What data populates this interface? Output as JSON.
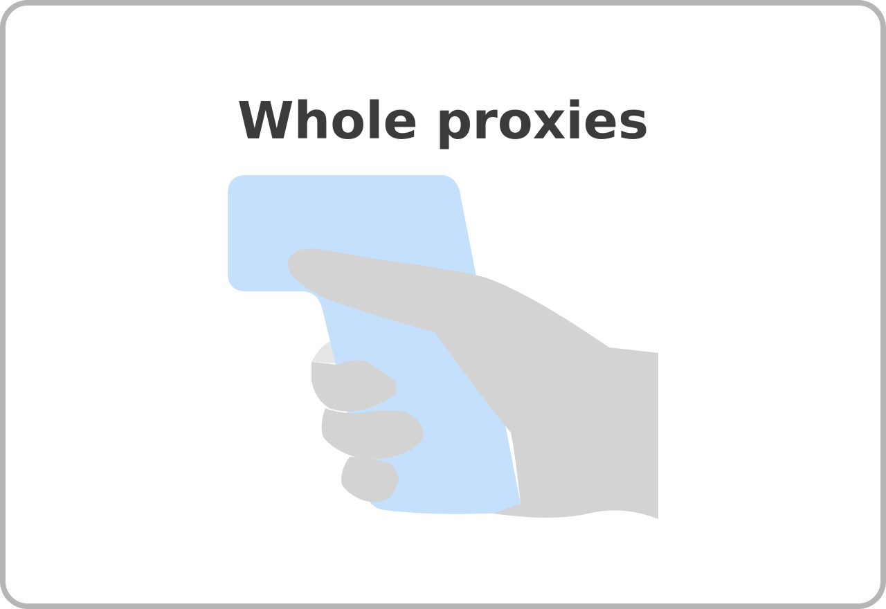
{
  "card": {
    "title": "Whole proxies"
  },
  "illustration": {
    "subject": "hand-holding-id-card",
    "colors": {
      "card_fill": "#c5e0fc",
      "hand_fill": "#d3d3d3",
      "shadow_fill": "#e6e6e6",
      "title_color": "#3b3b3b",
      "frame_border": "#b5b5b5"
    }
  }
}
